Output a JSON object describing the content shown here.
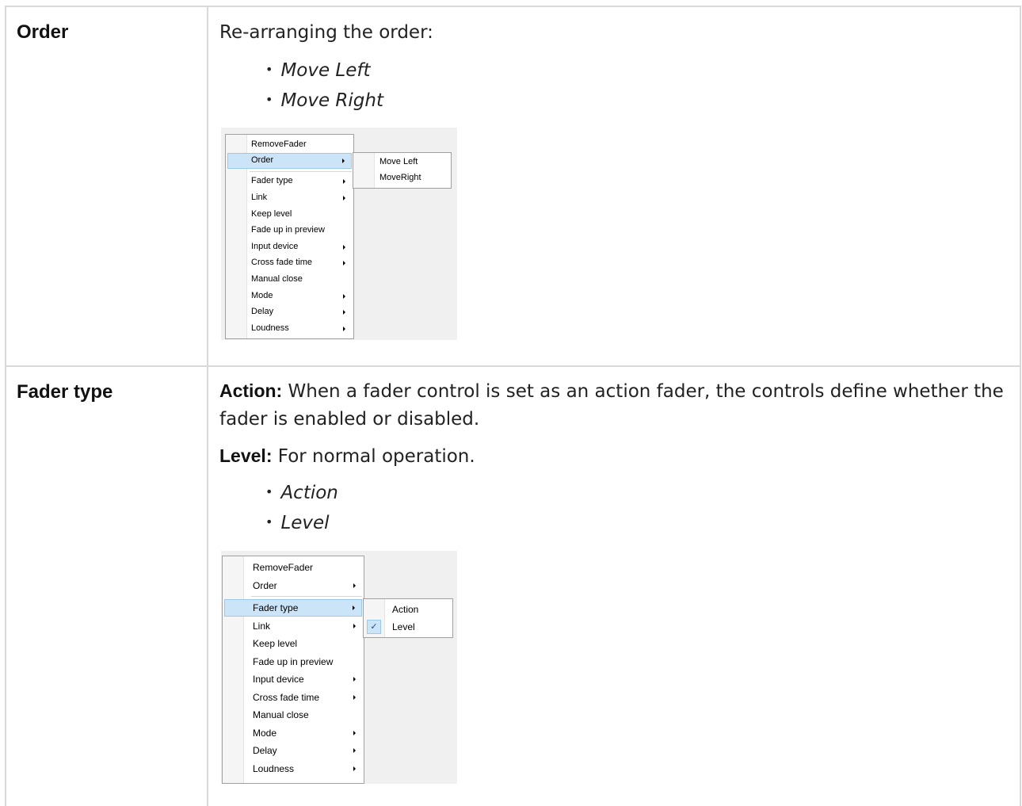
{
  "rows": [
    {
      "term": "Order",
      "intro": "Re-arranging the order:",
      "bullets": [
        "Move Left",
        "Move Right"
      ],
      "menu": {
        "items": [
          "RemoveFader",
          "Order",
          "Fader type",
          "Link",
          "Keep level",
          "Fade up in preview",
          "Input device",
          "Cross fade time",
          "Manual close",
          "Mode",
          "Delay",
          "Loudness"
        ],
        "submenu": [
          "Move Left",
          "MoveRight"
        ]
      }
    },
    {
      "term": "Fader type",
      "action_label": "Action:",
      "action_text": "When a fader control is set as an action fader, the controls define whether the fader is enabled or disabled.",
      "level_label": "Level:",
      "level_text": "For normal operation.",
      "bullets": [
        "Action",
        "Level"
      ],
      "menu": {
        "items": [
          "RemoveFader",
          "Order",
          "Fader type",
          "Link",
          "Keep level",
          "Fade up in preview",
          "Input device",
          "Cross fade time",
          "Manual close",
          "Mode",
          "Delay",
          "Loudness"
        ],
        "submenu": [
          "Action",
          "Level"
        ]
      }
    }
  ]
}
